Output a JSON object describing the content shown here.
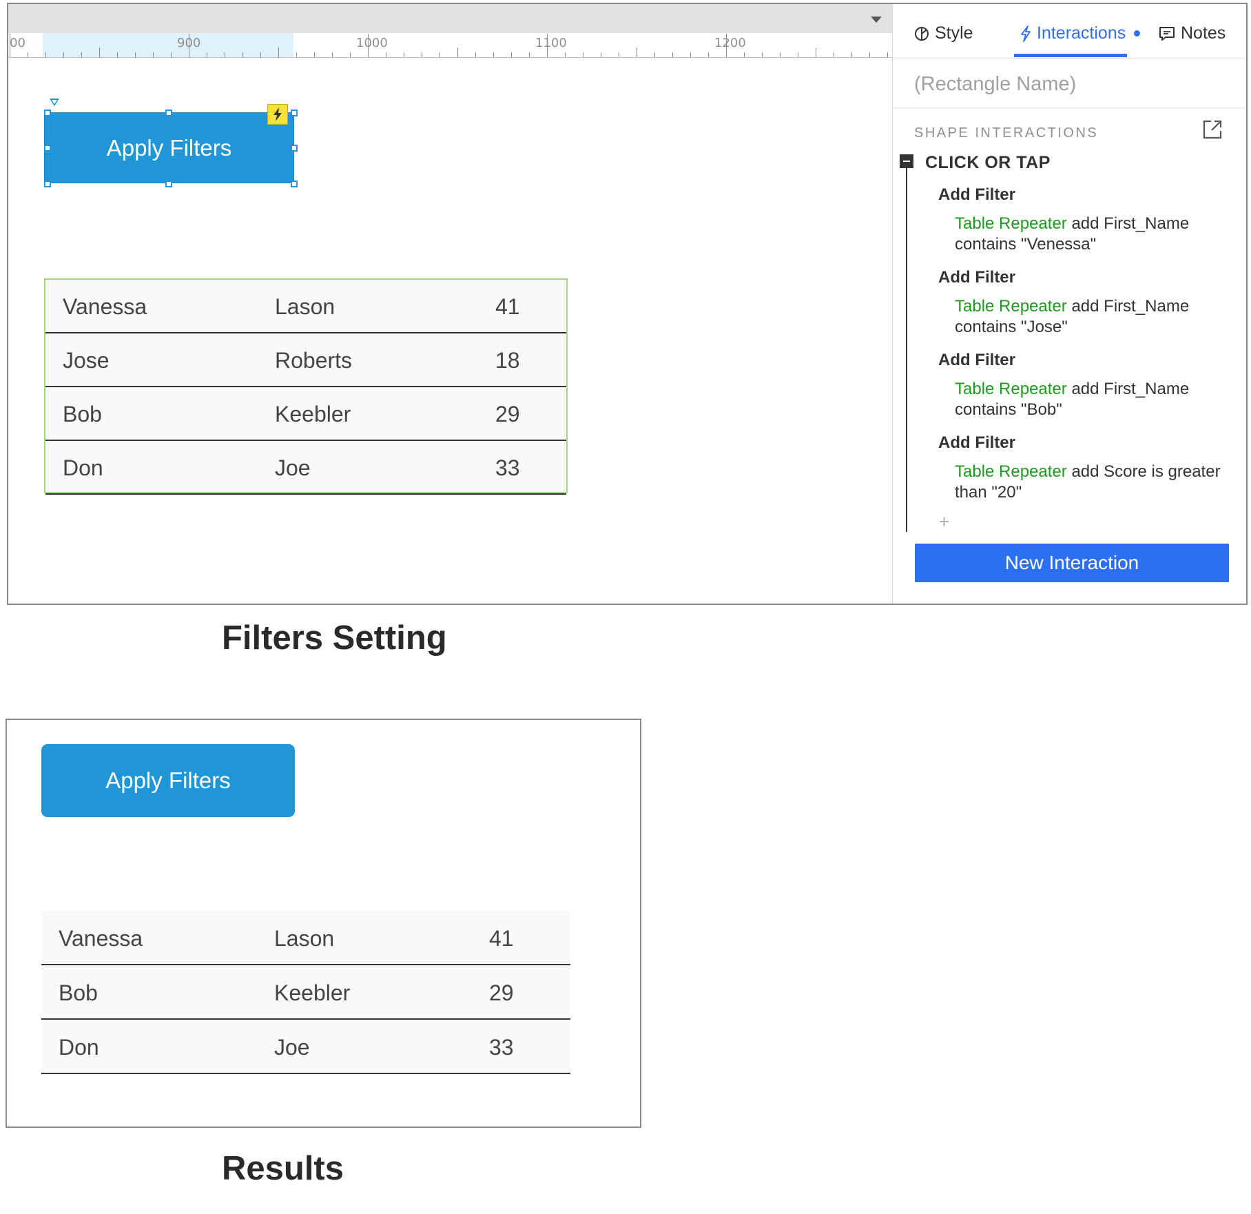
{
  "ruler": {
    "labels": [
      "00",
      "900",
      "1000",
      "1100",
      "1200"
    ]
  },
  "canvas": {
    "button_label": "Apply Filters",
    "table": [
      [
        "Vanessa",
        "Lason",
        "41"
      ],
      [
        "Jose",
        "Roberts",
        "18"
      ],
      [
        "Bob",
        "Keebler",
        "29"
      ],
      [
        "Don",
        "Joe",
        "33"
      ]
    ]
  },
  "panel": {
    "tabs": {
      "style": "Style",
      "interactions": "Interactions",
      "notes": "Notes"
    },
    "rect_name_placeholder": "(Rectangle Name)",
    "section_title": "SHAPE INTERACTIONS",
    "event": "CLICK OR TAP",
    "actions": [
      {
        "title": "Add Filter",
        "target": "Table Repeater",
        "text": " add First_Name contains \"Venessa\""
      },
      {
        "title": "Add Filter",
        "target": "Table Repeater",
        "text": " add First_Name contains \"Jose\""
      },
      {
        "title": "Add Filter",
        "target": "Table Repeater",
        "text": " add First_Name contains \"Bob\""
      },
      {
        "title": "Add Filter",
        "target": "Table Repeater",
        "text": " add Score is greater than \"20\""
      }
    ],
    "add_symbol": "+",
    "new_interaction": "New Interaction",
    "accent_color": "#2d6ff2",
    "target_color": "#1e9a1e"
  },
  "captions": {
    "filters_setting": "Filters Setting",
    "results": "Results"
  },
  "results": {
    "button_label": "Apply Filters",
    "table": [
      [
        "Vanessa",
        "Lason",
        "41"
      ],
      [
        "Bob",
        "Keebler",
        "29"
      ],
      [
        "Don",
        "Joe",
        "33"
      ]
    ]
  }
}
